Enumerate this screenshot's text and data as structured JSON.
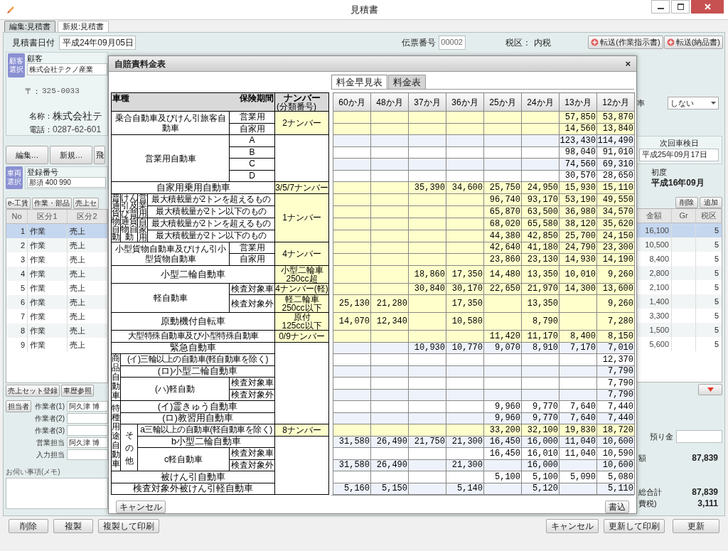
{
  "window": {
    "title": "見積書"
  },
  "tabs": [
    {
      "label": "編集:見積書",
      "selected": true
    },
    {
      "label": "新規:見積書",
      "selected": false
    }
  ],
  "header": {
    "date_label": "見積書日付",
    "date": "平成24年09月05日",
    "slip_label": "伝票番号",
    "slip": "00002",
    "tax_label": "税区：",
    "tax": "内税",
    "transfer_buttons": [
      "転送(作業指示書)",
      "転送(納品書)"
    ]
  },
  "customer": {
    "select_button": "顧客選択",
    "label": "顧客",
    "name": "株式会社テクノ産業",
    "postal_label": "〒：",
    "postal": "325-0033",
    "name_label": "名称：",
    "name_value": "株式会社テ",
    "phone_label": "電話：",
    "phone": "0287-62-601"
  },
  "customer_buttons": [
    "編集…",
    "新規…",
    "飛"
  ],
  "vehicle": {
    "select_button": "車両選択",
    "label": "登録番号",
    "plate": "那須 400 990"
  },
  "detail_tabs": [
    "e-工賃",
    "作業・部品",
    "売上セ"
  ],
  "lines": {
    "columns": [
      "No",
      "区分1",
      "区分2"
    ],
    "rows": [
      {
        "no": "1",
        "kind1": "作業",
        "kind2": "売上",
        "selected": true
      },
      {
        "no": "2",
        "kind1": "作業",
        "kind2": "売上",
        "selected": false
      },
      {
        "no": "3",
        "kind1": "作業",
        "kind2": "売上",
        "selected": false
      },
      {
        "no": "4",
        "kind1": "作業",
        "kind2": "売上",
        "selected": false
      },
      {
        "no": "5",
        "kind1": "作業",
        "kind2": "売上",
        "selected": false
      },
      {
        "no": "6",
        "kind1": "作業",
        "kind2": "売上",
        "selected": false
      },
      {
        "no": "7",
        "kind1": "作業",
        "kind2": "売上",
        "selected": false
      },
      {
        "no": "8",
        "kind1": "作業",
        "kind2": "売上",
        "selected": false
      },
      {
        "no": "9",
        "kind1": "作業",
        "kind2": "売上",
        "selected": false
      }
    ]
  },
  "line_buttons": [
    "売上セット登録",
    "車歴参照"
  ],
  "staff": {
    "button": "担当者",
    "fields": [
      {
        "label": "作業者(1)",
        "value": "阿久津 博"
      },
      {
        "label": "作業者(2)"
      },
      {
        "label": "作業者(3)"
      },
      {
        "label": "営業担当",
        "value": "阿久津 博"
      },
      {
        "label": "入力担当"
      }
    ]
  },
  "memo": {
    "label": "お伺い事項(メモ)"
  },
  "footer_buttons": [
    "削除",
    "複製",
    "複製して印刷"
  ],
  "summary": {
    "rate_label": "率",
    "rate": "しない",
    "inspection_label": "次回車検日",
    "inspection": "平成25年09月17日",
    "first_label": "初度",
    "first": "平成16年09月",
    "row_buttons": [
      "削除",
      "追加"
    ],
    "columns": [
      "金額",
      "Gr",
      "税区"
    ],
    "rows": [
      {
        "amount": "16,100",
        "tax": "5",
        "selected": true
      },
      {
        "amount": "10,500",
        "tax": "5",
        "selected": false
      },
      {
        "amount": "8,400",
        "tax": "5",
        "selected": false
      },
      {
        "amount": "2,800",
        "tax": "5",
        "selected": false
      },
      {
        "amount": "2,100",
        "tax": "5",
        "selected": false
      },
      {
        "amount": "1,400",
        "tax": "5",
        "selected": false
      },
      {
        "amount": "3,300",
        "tax": "5",
        "selected": false
      },
      {
        "amount": "1,500",
        "tax": "5",
        "selected": false
      },
      {
        "amount": "5,600",
        "tax": "5",
        "selected": false
      }
    ],
    "deposit_label": "預り金",
    "amount_label": "額",
    "amount": "87,839",
    "total_label": "総合計",
    "total": "87,839",
    "tax_label": "費税)",
    "tax": "3,111"
  },
  "footer_right_buttons": [
    "キャンセル",
    "更新して印刷",
    "更新"
  ],
  "dialog": {
    "title": "自賠責料金表",
    "close": "×",
    "tabs": [
      {
        "label": "料金早見表",
        "selected": true
      },
      {
        "label": "料金表",
        "selected": false
      }
    ],
    "vehicle_table": {
      "header": {
        "type": "車種",
        "period": "保険期間",
        "plate": "ナンバー",
        "plate_note": "(分類番号)"
      },
      "rows": [
        [
          {
            "text": "乗合自動車及びけん引旅客自動車",
            "colspan": 4,
            "rowspan": 2
          },
          {
            "text": "営業用"
          },
          {
            "text": "2ナンバー",
            "rowspan": 2,
            "color": "#ffffcc"
          }
        ],
        [
          {
            "text": "自家用"
          }
        ],
        [
          {
            "text": "営業用自動車",
            "colspan": 4,
            "rowspan": 4
          },
          {
            "text": "A"
          },
          {
            "rowspan": 4
          }
        ],
        [
          {
            "text": "B"
          }
        ],
        [
          {
            "text": "C"
          }
        ],
        [
          {
            "text": "D"
          }
        ],
        [
          {
            "text": "自家用乗用自動車",
            "colspan": 5
          },
          {
            "text": "3/5/7ナンバー",
            "color": "#ffffcc"
          }
        ],
        [
          {
            "text": "普通貨物自動",
            "rowspan": 4,
            "vertical": true
          },
          {
            "text": "けん引及び普通貨物自動",
            "rowspan": 4,
            "vertical": true
          },
          {
            "text": "営業用",
            "rowspan": 2,
            "vertical": true
          },
          {
            "text": "最大積載量が2トンを超えるもの",
            "colspan": 2
          },
          {
            "text": "1ナンバー",
            "rowspan": 4,
            "color": "#ffffcc"
          }
        ],
        [
          {
            "text": "最大積載量が2トン以下のもの",
            "colspan": 2
          }
        ],
        [
          {
            "text": "自家用",
            "rowspan": 2,
            "vertical": true
          },
          {
            "text": "最大積載量が2トンを超えるもの",
            "colspan": 2
          }
        ],
        [
          {
            "text": "最大積載量が2トン以下のもの",
            "colspan": 2
          }
        ],
        [
          {
            "text": "小型貨物自動車及びけん引小型貨物自動車",
            "colspan": 4,
            "rowspan": 2
          },
          {
            "text": "営業用"
          },
          {
            "text": "4ナンバー",
            "rowspan": 2,
            "color": "#ffffcc"
          }
        ],
        [
          {
            "text": "自家用"
          }
        ],
        [
          {
            "text": "小型二輪自動車",
            "colspan": 5
          },
          {
            "text": "小型二輪車 250cc超",
            "color": "#ffffcc"
          }
        ],
        [
          {
            "text": "軽自動車",
            "colspan": 4,
            "rowspan": 2
          },
          {
            "text": "検査対象車"
          },
          {
            "text": "4ナンバー(軽)",
            "color": "#ffffcc"
          }
        ],
        [
          {
            "text": "検査対象外"
          },
          {
            "text": "軽二輪車 250cc以下",
            "color": "#ffffcc"
          }
        ],
        [
          {
            "text": "原動機付自転車",
            "colspan": 5
          },
          {
            "text": "原付 125cc以下",
            "color": "#ffffcc"
          }
        ],
        [
          {
            "text": "大型特殊自動車及び小型特殊自動車",
            "colspan": 5
          },
          {
            "text": "0/9ナンバー",
            "color": "#ffffcc"
          }
        ],
        [
          {
            "text": "緊急自動車",
            "colspan": 5
          },
          {
            "rowspan": 7
          }
        ],
        [
          {
            "text": "商品自動車",
            "rowspan": 4,
            "vertical": true
          },
          {
            "text": "(イ)三輪以上の自動車(軽自動車を除く)",
            "colspan": 4
          }
        ],
        [
          {
            "text": "(ロ)小型二輪自動車",
            "colspan": 4
          }
        ],
        [
          {
            "text": "(ハ)軽自動",
            "colspan": 3,
            "rowspan": 2
          },
          {
            "text": "検査対象車"
          }
        ],
        [
          {
            "text": "検査対象外"
          }
        ],
        [
          {
            "text": "特種用途自動車",
            "rowspan": 6,
            "vertical": true
          },
          {
            "text": "(イ)霊きゅう自動車",
            "colspan": 4
          }
        ],
        [
          {
            "text": "(ロ)教習用自動車",
            "colspan": 4
          }
        ],
        [
          {
            "text": "その他",
            "rowspan": 4,
            "vertical": true
          },
          {
            "text": "a三輪以上の自動車(軽自動車を除く)",
            "colspan": 3
          },
          {
            "text": "8ナンバー",
            "color": "#ffffcc"
          }
        ],
        [
          {
            "text": "b小型二輪自動車",
            "colspan": 3
          },
          {
            "rowspan": 5
          }
        ],
        [
          {
            "text": "c軽自動車",
            "colspan": 2,
            "rowspan": 2
          },
          {
            "text": "検査対象車"
          }
        ],
        [
          {
            "text": "検査対象外"
          }
        ],
        [
          {
            "text": "被けん引自動車",
            "colspan": 5
          }
        ],
        [
          {
            "text": "検査対象外被けん引軽自動車",
            "colspan": 5
          }
        ]
      ]
    },
    "rate_table": {
      "columns": [
        "60か月",
        "48か月",
        "37か月",
        "36か月",
        "25か月",
        "24か月",
        "13か月",
        "12か月"
      ],
      "rows": [
        {
          "color": "#ffffcc",
          "cells": [
            {
              "kind": "blank"
            },
            {
              "kind": "blank"
            },
            {
              "kind": "blank"
            },
            {
              "kind": "blank"
            },
            {
              "kind": "blank"
            },
            {
              "kind": "blank"
            },
            {
              "kind": "amount",
              "value": "57,850"
            },
            {
              "kind": "amount",
              "value": "53,870"
            }
          ]
        },
        {
          "color": "#ffffcc",
          "cells": [
            {
              "kind": "blank"
            },
            {
              "kind": "blank"
            },
            {
              "kind": "blank"
            },
            {
              "kind": "blank"
            },
            {
              "kind": "blank"
            },
            {
              "kind": "blank"
            },
            {
              "kind": "amount",
              "value": "14,560"
            },
            {
              "kind": "amount",
              "value": "13,840"
            }
          ]
        },
        {
          "color": "#eef2fa",
          "cells": [
            {
              "kind": "blank"
            },
            {
              "kind": "blank"
            },
            {
              "kind": "blank"
            },
            {
              "kind": "blank"
            },
            {
              "kind": "blank"
            },
            {
              "kind": "blank"
            },
            {
              "kind": "amount",
              "value": "123,430"
            },
            {
              "kind": "amount",
              "value": "114,490"
            }
          ]
        },
        {
          "color": "#ffffff",
          "cells": [
            {
              "kind": "blank"
            },
            {
              "kind": "blank"
            },
            {
              "kind": "blank"
            },
            {
              "kind": "blank"
            },
            {
              "kind": "blank"
            },
            {
              "kind": "blank"
            },
            {
              "kind": "amount",
              "value": "98,040"
            },
            {
              "kind": "amount",
              "value": "91,010"
            }
          ]
        },
        {
          "color": "#eef2fa",
          "cells": [
            {
              "kind": "blank"
            },
            {
              "kind": "blank"
            },
            {
              "kind": "blank"
            },
            {
              "kind": "blank"
            },
            {
              "kind": "blank"
            },
            {
              "kind": "blank"
            },
            {
              "kind": "amount",
              "value": "74,560"
            },
            {
              "kind": "amount",
              "value": "69,310"
            }
          ]
        },
        {
          "color": "#ffffff",
          "cells": [
            {
              "kind": "blank"
            },
            {
              "kind": "blank"
            },
            {
              "kind": "blank"
            },
            {
              "kind": "blank"
            },
            {
              "kind": "blank"
            },
            {
              "kind": "blank"
            },
            {
              "kind": "amount",
              "value": "30,570"
            },
            {
              "kind": "amount",
              "value": "28,650"
            }
          ]
        },
        {
          "color": "#ffffcc",
          "cells": [
            {
              "kind": "blank"
            },
            {
              "kind": "blank"
            },
            {
              "kind": "amount",
              "value": "35,390"
            },
            {
              "kind": "amount",
              "value": "34,600"
            },
            {
              "kind": "amount",
              "value": "25,750"
            },
            {
              "kind": "amount",
              "value": "24,950"
            },
            {
              "kind": "amount",
              "value": "15,930"
            },
            {
              "kind": "amount",
              "value": "15,110"
            }
          ]
        },
        {
          "color": "#ffffcc",
          "cells": [
            {
              "kind": "blank"
            },
            {
              "kind": "blank"
            },
            {
              "kind": "blank"
            },
            {
              "kind": "blank"
            },
            {
              "kind": "amount",
              "value": "96,740"
            },
            {
              "kind": "amount",
              "value": "93,170"
            },
            {
              "kind": "amount",
              "value": "53,190"
            },
            {
              "kind": "amount",
              "value": "49,550"
            }
          ]
        },
        {
          "color": "#ffffcc",
          "cells": [
            {
              "kind": "blank"
            },
            {
              "kind": "blank"
            },
            {
              "kind": "blank"
            },
            {
              "kind": "blank"
            },
            {
              "kind": "amount",
              "value": "65,870"
            },
            {
              "kind": "amount",
              "value": "63,500"
            },
            {
              "kind": "amount",
              "value": "36,980"
            },
            {
              "kind": "amount",
              "value": "34,570"
            }
          ]
        },
        {
          "color": "#ffffcc",
          "cells": [
            {
              "kind": "blank"
            },
            {
              "kind": "blank"
            },
            {
              "kind": "blank"
            },
            {
              "kind": "blank"
            },
            {
              "kind": "amount",
              "value": "68,020"
            },
            {
              "kind": "amount",
              "value": "65,580"
            },
            {
              "kind": "amount",
              "value": "38,120"
            },
            {
              "kind": "amount",
              "value": "35,620"
            }
          ]
        },
        {
          "color": "#ffffcc",
          "cells": [
            {
              "kind": "blank"
            },
            {
              "kind": "blank"
            },
            {
              "kind": "blank"
            },
            {
              "kind": "blank"
            },
            {
              "kind": "amount",
              "value": "44,380"
            },
            {
              "kind": "amount",
              "value": "42,850"
            },
            {
              "kind": "amount",
              "value": "25,700"
            },
            {
              "kind": "amount",
              "value": "24,150"
            }
          ]
        },
        {
          "color": "#ffffcc",
          "cells": [
            {
              "kind": "blank"
            },
            {
              "kind": "blank"
            },
            {
              "kind": "blank"
            },
            {
              "kind": "blank"
            },
            {
              "kind": "amount",
              "value": "42,640"
            },
            {
              "kind": "amount",
              "value": "41,180"
            },
            {
              "kind": "amount",
              "value": "24,790"
            },
            {
              "kind": "amount",
              "value": "23,300"
            }
          ]
        },
        {
          "color": "#ffffcc",
          "cells": [
            {
              "kind": "blank"
            },
            {
              "kind": "blank"
            },
            {
              "kind": "blank"
            },
            {
              "kind": "blank"
            },
            {
              "kind": "amount",
              "value": "23,860"
            },
            {
              "kind": "amount",
              "value": "23,130"
            },
            {
              "kind": "amount",
              "value": "14,930"
            },
            {
              "kind": "amount",
              "value": "14,190"
            }
          ]
        },
        {
          "color": "#ffffcc",
          "cells": [
            {
              "kind": "blank"
            },
            {
              "kind": "blank"
            },
            {
              "kind": "amount",
              "value": "18,860"
            },
            {
              "kind": "amount",
              "value": "17,350"
            },
            {
              "kind": "amount",
              "value": "14,480"
            },
            {
              "kind": "amount",
              "value": "13,350"
            },
            {
              "kind": "amount",
              "value": "10,010"
            },
            {
              "kind": "amount",
              "value": "9,260"
            }
          ]
        },
        {
          "color": "#ffffcc",
          "cells": [
            {
              "kind": "blank"
            },
            {
              "kind": "blank"
            },
            {
              "kind": "amount",
              "value": "30,840"
            },
            {
              "kind": "amount",
              "value": "30,170"
            },
            {
              "kind": "amount",
              "value": "22,650"
            },
            {
              "kind": "amount",
              "value": "21,970"
            },
            {
              "kind": "amount",
              "value": "14,300"
            },
            {
              "kind": "amount",
              "value": "13,600"
            }
          ]
        },
        {
          "color": "#ffffcc",
          "cells": [
            {
              "kind": "amount",
              "value": "25,130"
            },
            {
              "kind": "amount",
              "value": "21,280"
            },
            {
              "kind": "blank"
            },
            {
              "kind": "amount",
              "value": "17,350"
            },
            {
              "kind": "blank"
            },
            {
              "kind": "amount",
              "value": "13,350"
            },
            {
              "kind": "blank"
            },
            {
              "kind": "amount",
              "value": "9,260"
            }
          ]
        },
        {
          "color": "#ffffcc",
          "cells": [
            {
              "kind": "amount",
              "value": "14,070"
            },
            {
              "kind": "amount",
              "value": "12,340"
            },
            {
              "kind": "blank"
            },
            {
              "kind": "amount",
              "value": "10,580"
            },
            {
              "kind": "blank"
            },
            {
              "kind": "amount",
              "value": "8,790"
            },
            {
              "kind": "blank"
            },
            {
              "kind": "amount",
              "value": "7,280"
            }
          ]
        },
        {
          "color": "#ffffcc",
          "cells": [
            {
              "kind": "blank"
            },
            {
              "kind": "blank"
            },
            {
              "kind": "blank"
            },
            {
              "kind": "blank"
            },
            {
              "kind": "amount",
              "value": "11,420"
            },
            {
              "kind": "amount",
              "value": "11,170"
            },
            {
              "kind": "amount",
              "value": "8,400"
            },
            {
              "kind": "amount",
              "value": "8,150"
            }
          ]
        },
        {
          "color": "#eef2fa",
          "cells": [
            {
              "kind": "blank"
            },
            {
              "kind": "blank"
            },
            {
              "kind": "amount",
              "value": "10,930"
            },
            {
              "kind": "amount",
              "value": "10,770"
            },
            {
              "kind": "amount",
              "value": "9,070"
            },
            {
              "kind": "amount",
              "value": "8,910"
            },
            {
              "kind": "amount",
              "value": "7,170"
            },
            {
              "kind": "amount",
              "value": "7,010"
            }
          ]
        },
        {
          "color": "#ffffff",
          "cells": [
            {
              "kind": "blank"
            },
            {
              "kind": "blank"
            },
            {
              "kind": "blank"
            },
            {
              "kind": "blank"
            },
            {
              "kind": "blank"
            },
            {
              "kind": "blank"
            },
            {
              "kind": "blank"
            },
            {
              "kind": "amount",
              "value": "12,370"
            }
          ]
        },
        {
          "color": "#eef2fa",
          "cells": [
            {
              "kind": "blank"
            },
            {
              "kind": "blank"
            },
            {
              "kind": "blank"
            },
            {
              "kind": "blank"
            },
            {
              "kind": "blank"
            },
            {
              "kind": "blank"
            },
            {
              "kind": "blank"
            },
            {
              "kind": "amount",
              "value": "7,790"
            }
          ]
        },
        {
          "color": "#ffffff",
          "cells": [
            {
              "kind": "blank"
            },
            {
              "kind": "blank"
            },
            {
              "kind": "blank"
            },
            {
              "kind": "blank"
            },
            {
              "kind": "blank"
            },
            {
              "kind": "blank"
            },
            {
              "kind": "blank"
            },
            {
              "kind": "amount",
              "value": "7,790"
            }
          ]
        },
        {
          "color": "#eef2fa",
          "cells": [
            {
              "kind": "blank"
            },
            {
              "kind": "blank"
            },
            {
              "kind": "blank"
            },
            {
              "kind": "blank"
            },
            {
              "kind": "blank"
            },
            {
              "kind": "blank"
            },
            {
              "kind": "blank"
            },
            {
              "kind": "amount",
              "value": "7,790"
            }
          ]
        },
        {
          "color": "#ffffff",
          "cells": [
            {
              "kind": "blank"
            },
            {
              "kind": "blank"
            },
            {
              "kind": "blank"
            },
            {
              "kind": "blank"
            },
            {
              "kind": "amount",
              "value": "9,960"
            },
            {
              "kind": "amount",
              "value": "9,770"
            },
            {
              "kind": "amount",
              "value": "7,640"
            },
            {
              "kind": "amount",
              "value": "7,440"
            }
          ]
        },
        {
          "color": "#eef2fa",
          "cells": [
            {
              "kind": "blank"
            },
            {
              "kind": "blank"
            },
            {
              "kind": "blank"
            },
            {
              "kind": "blank"
            },
            {
              "kind": "amount",
              "value": "9,960"
            },
            {
              "kind": "amount",
              "value": "9,770"
            },
            {
              "kind": "amount",
              "value": "7,640"
            },
            {
              "kind": "amount",
              "value": "7,440"
            }
          ]
        },
        {
          "color": "#ffffcc",
          "cells": [
            {
              "kind": "blank"
            },
            {
              "kind": "blank"
            },
            {
              "kind": "blank"
            },
            {
              "kind": "blank"
            },
            {
              "kind": "amount",
              "value": "33,200"
            },
            {
              "kind": "amount",
              "value": "32,100"
            },
            {
              "kind": "amount",
              "value": "19,830"
            },
            {
              "kind": "amount",
              "value": "18,720"
            }
          ]
        },
        {
          "color": "#eef2fa",
          "cells": [
            {
              "kind": "amount",
              "value": "31,580"
            },
            {
              "kind": "amount",
              "value": "26,490"
            },
            {
              "kind": "amount",
              "value": "21,750"
            },
            {
              "kind": "amount",
              "value": "21,300"
            },
            {
              "kind": "amount",
              "value": "16,450"
            },
            {
              "kind": "amount",
              "value": "16,000"
            },
            {
              "kind": "amount",
              "value": "11,040"
            },
            {
              "kind": "amount",
              "value": "10,600"
            }
          ]
        },
        {
          "color": "#ffffff",
          "cells": [
            {
              "kind": "blank"
            },
            {
              "kind": "blank"
            },
            {
              "kind": "blank"
            },
            {
              "kind": "blank"
            },
            {
              "kind": "amount",
              "value": "16,450"
            },
            {
              "kind": "amount",
              "value": "16,010"
            },
            {
              "kind": "amount",
              "value": "11,040"
            },
            {
              "kind": "amount",
              "value": "10,590"
            }
          ]
        },
        {
          "color": "#eef2fa",
          "cells": [
            {
              "kind": "amount",
              "value": "31,580"
            },
            {
              "kind": "amount",
              "value": "26,490"
            },
            {
              "kind": "blank"
            },
            {
              "kind": "amount",
              "value": "21,300"
            },
            {
              "kind": "blank"
            },
            {
              "kind": "amount",
              "value": "16,000"
            },
            {
              "kind": "blank"
            },
            {
              "kind": "amount",
              "value": "10,600"
            }
          ]
        },
        {
          "color": "#ffffff",
          "cells": [
            {
              "kind": "blank"
            },
            {
              "kind": "blank"
            },
            {
              "kind": "blank"
            },
            {
              "kind": "blank"
            },
            {
              "kind": "amount",
              "value": "5,100"
            },
            {
              "kind": "amount",
              "value": "5,100"
            },
            {
              "kind": "amount",
              "value": "5,090"
            },
            {
              "kind": "amount",
              "value": "5,080"
            }
          ]
        },
        {
          "color": "#eef2fa",
          "cells": [
            {
              "kind": "amount",
              "value": "5,160"
            },
            {
              "kind": "amount",
              "value": "5,150"
            },
            {
              "kind": "blank"
            },
            {
              "kind": "amount",
              "value": "5,140"
            },
            {
              "kind": "blank"
            },
            {
              "kind": "amount",
              "value": "5,120"
            },
            {
              "kind": "blank"
            },
            {
              "kind": "amount",
              "value": "5,110"
            }
          ]
        }
      ]
    },
    "buttons": [
      "キャンセル",
      "書込"
    ]
  }
}
